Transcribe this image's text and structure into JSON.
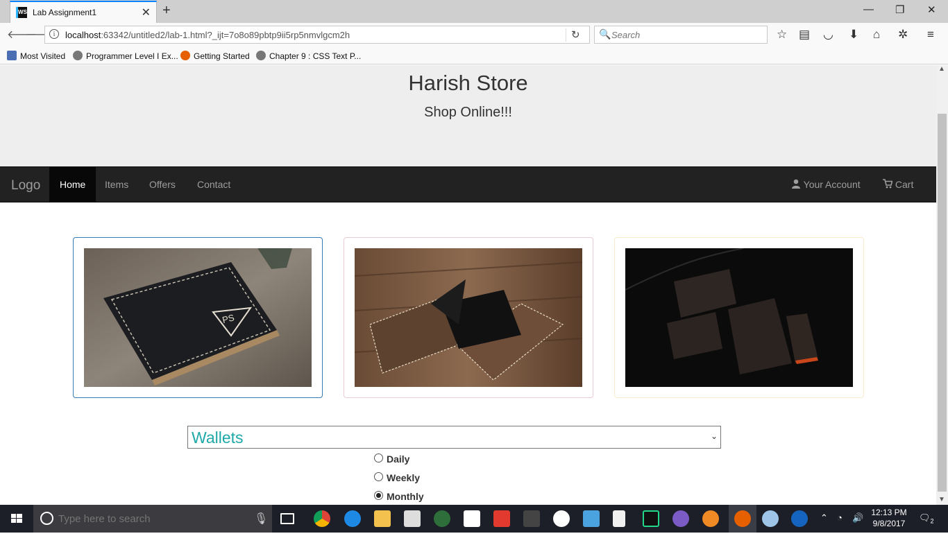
{
  "browser": {
    "tab_title": "Lab Assignment1",
    "url_host": "localhost",
    "url_rest": ":63342/untitled2/lab-1.html?_ijt=7o8o89pbtp9ii5rp5nmvlgcm2h",
    "search_placeholder": "Search",
    "bookmarks": [
      "Most Visited",
      "Programmer Level I Ex...",
      "Getting Started",
      "Chapter 9 : CSS Text P..."
    ]
  },
  "page": {
    "store_title": "Harish Store",
    "store_subtitle": "Shop Online!!!",
    "nav": {
      "brand": "Logo",
      "links": [
        "Home",
        "Items",
        "Offers",
        "Contact"
      ],
      "active": "Home",
      "account": "Your Account",
      "cart": "Cart"
    },
    "category": {
      "selected": "Wallets"
    },
    "frequency": {
      "options": [
        "Daily",
        "Weekly",
        "Monthly"
      ],
      "selected": "Monthly"
    }
  },
  "taskbar": {
    "search_placeholder": "Type here to search",
    "time": "12:13 PM",
    "date": "9/8/2017",
    "notification_count": "2"
  },
  "colors": {
    "navbar_bg": "#222222",
    "jumbotron_bg": "#eeeeee",
    "select_text": "#20a8a8",
    "taskbar_bg": "#1d1f28"
  }
}
